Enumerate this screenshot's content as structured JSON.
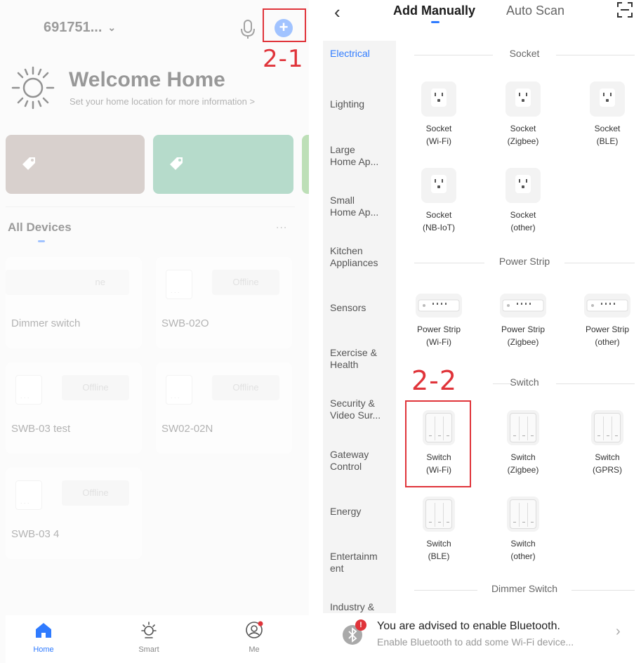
{
  "left": {
    "home_name": "691751...",
    "home_chevron": "⌄",
    "add_symbol": "+",
    "annotation": "2-1",
    "welcome_title": "Welcome Home",
    "welcome_sub": "Set your home location for more information >",
    "cards": [
      {
        "color": "#a89890"
      },
      {
        "color": "#5daf8c"
      },
      {
        "color": "#6db85f"
      }
    ],
    "all_devices": "All Devices",
    "more": "...",
    "devices": [
      {
        "name": "Dimmer switch",
        "status": "ne"
      },
      {
        "name": "SWB-02O",
        "status": "Offline"
      },
      {
        "name": "SWB-03 test",
        "status": "Offline"
      },
      {
        "name": "SW02-02N",
        "status": "Offline"
      },
      {
        "name": "SWB-03 4",
        "status": "Offline"
      }
    ],
    "nav": [
      {
        "label": "Home",
        "icon": "home-icon"
      },
      {
        "label": "Smart",
        "icon": "sun-icon"
      },
      {
        "label": "Me",
        "icon": "user-icon"
      }
    ]
  },
  "right": {
    "back": "‹",
    "tab_manual": "Add Manually",
    "tab_scan": "Auto Scan",
    "categories": [
      "Electrical",
      "Lighting",
      "Large\nHome Ap...",
      "Small\nHome Ap...",
      "Kitchen\nAppliances",
      "Sensors",
      "Exercise &\nHealth",
      "Security &\nVideo Sur...",
      "Gateway\nControl",
      "Energy",
      "Entertainm\nent",
      "Industry &"
    ],
    "sections": {
      "socket": "Socket",
      "power_strip": "Power Strip",
      "switch": "Switch",
      "dimmer": "Dimmer Switch"
    },
    "sockets": [
      "Socket\n(Wi-Fi)",
      "Socket\n(Zigbee)",
      "Socket\n(BLE)",
      "Socket\n(NB-IoT)",
      "Socket\n(other)"
    ],
    "strips": [
      "Power Strip\n(Wi-Fi)",
      "Power Strip\n(Zigbee)",
      "Power Strip\n(other)"
    ],
    "switches": [
      "Switch\n(Wi-Fi)",
      "Switch\n(Zigbee)",
      "Switch\n(GPRS)",
      "Switch\n(BLE)",
      "Switch\n(other)"
    ],
    "annotation": "2-2",
    "bluetooth": {
      "badge": "!",
      "title": "You are advised to enable Bluetooth.",
      "sub": "Enable Bluetooth to add some Wi-Fi device...",
      "chevron": "›"
    }
  },
  "colors": {
    "accent": "#2f7bff",
    "annotation": "#e0343a"
  }
}
